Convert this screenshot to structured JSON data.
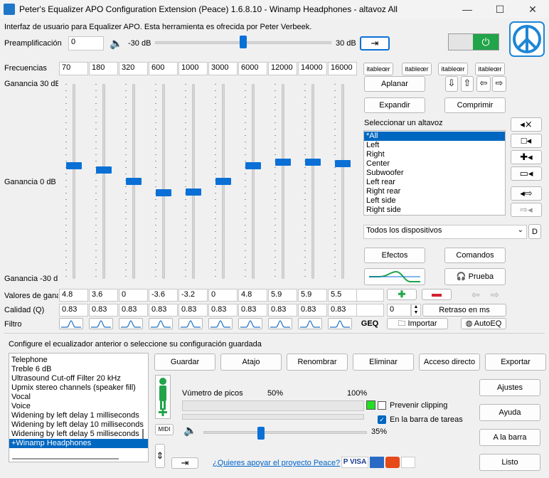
{
  "title": "Peter's Equalizer APO Configuration Extension (Peace) 1.6.8.10 - Winamp Headphones - altavoz All",
  "window": {
    "minimize": "—",
    "maximize": "☐",
    "close": "✕"
  },
  "intro": "Interfaz de usuario para Equalizer APO. Esta herramienta es ofrecida por Peter Verbeek.",
  "preamp": {
    "label": "Preamplificación",
    "value": "0",
    "min": "-30 dB",
    "max": "30 dB",
    "level": 0.5
  },
  "freq_label": "Frecuencias",
  "frequencies": [
    "70",
    "180",
    "320",
    "600",
    "1000",
    "3000",
    "6000",
    "12000",
    "14000",
    "16000"
  ],
  "table_btns": [
    "itableœr",
    "itableœr",
    "itableœr",
    "itableœr"
  ],
  "gain_top": "Ganancia 30 dE",
  "gain_mid": "Ganancia 0 dB",
  "gain_bot": "Ganancia -30 dl",
  "gains": [
    4.8,
    3.6,
    0,
    -3.6,
    -3.2,
    0,
    4.8,
    5.9,
    5.9,
    5.5
  ],
  "values_label": "Valores de gana",
  "gain_texts": [
    "4.8",
    "3.6",
    "0",
    "-3.6",
    "-3.2",
    "0",
    "4.8",
    "5.9",
    "5.9",
    "5.5"
  ],
  "quality_label": "Calidad (Q)",
  "qualities": [
    "0.83",
    "0.83",
    "0.83",
    "0.83",
    "0.83",
    "0.83",
    "0.83",
    "0.83",
    "0.83",
    "0.83"
  ],
  "filter_label": "Filtro",
  "buttons": {
    "aplanar": "Aplanar",
    "expandir": "Expandir",
    "comprimir": "Comprimir",
    "efectos": "Efectos",
    "comandos": "Comandos",
    "prueba": "Prueba",
    "delay_value": "0",
    "retraso": "Retraso en ms",
    "geq": "GEQ",
    "importar": "Importar",
    "autoeq": "AutoEQ",
    "d": "D"
  },
  "speaker": {
    "label": "Seleccionar un altavoz",
    "items": [
      "*All",
      "Left",
      "Right",
      "Center",
      "Subwoofer",
      "Left rear",
      "Right rear",
      "Left side",
      "Right side"
    ],
    "selected": 0
  },
  "devices": "Todos los dispositivos",
  "config_label": "Configure el ecualizador anterior o seleccione su configuración guardada",
  "configs": [
    "Telephone",
    "Treble 6 dB",
    "Ultrasound Cut-off Filter 20 kHz",
    "Upmix stereo channels (speaker fill)",
    "Vocal",
    "Voice",
    "Widening by left delay 1 milliseconds",
    "Widening by left delay 10 milliseconds",
    "Widening by left delay 5 milliseconds",
    "+Winamp Headphones"
  ],
  "config_selected": 9,
  "actions": [
    "Guardar",
    "Atajo",
    "Renombrar",
    "Eliminar",
    "Acceso directo",
    "Exportar"
  ],
  "side": [
    "Ajustes",
    "Ayuda",
    "A la barra",
    "Listo"
  ],
  "meter": {
    "label": "Vúmetro de picos",
    "p50": "50%",
    "p100": "100%"
  },
  "midi": "MIDI",
  "prevent": "Prevenir clipping",
  "taskbar": "En la barra de tareas",
  "volume": {
    "text": "35%",
    "level": 0.35
  },
  "support": "¿Quieres apoyar el proyecto Peace?",
  "colors": {
    "accent": "#0a70d6",
    "power": "#21a44a",
    "selected": "#0067c0",
    "link": "#0066cc"
  }
}
